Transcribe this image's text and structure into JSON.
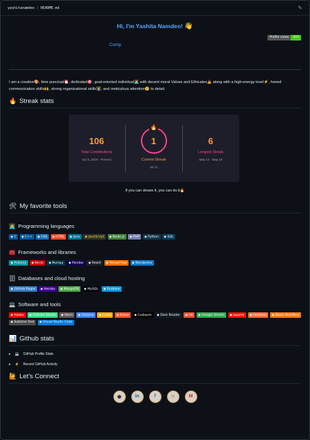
{
  "header": {
    "user": "yashitanamdeo",
    "sep": " / ",
    "file": "README.md",
    "edit_icon": "pencil-icon"
  },
  "hero": {
    "greeting": "Hi, I'm Yashita Namdeo!",
    "wave": "👋",
    "profile_views_label": "Profile views",
    "profile_views_count": "323",
    "typing_text": "Comp"
  },
  "intro": {
    "p1": "I am a creative",
    "p2": ", time punctual",
    "p3": ", dedicated",
    "p4": ", goal-oriented individual",
    "p5": " with decent moral Values and Ethicates",
    "p6": " along with a high-energy level",
    "p7": ", honed communication skills",
    "p8": ", strong organizational skills",
    "p9": ", and meticulous attention",
    "p10": " to detail."
  },
  "streak": {
    "heading": "Streak stats",
    "total": "106",
    "total_label": "Total Contributions",
    "total_range": "Apr 5, 2019 - Present",
    "current": "1",
    "current_label": "Current Streak",
    "current_range": "Jul 11",
    "longest": "6",
    "longest_label": "Longest Streak",
    "longest_range": "May 14 - May 19",
    "motto": "If you can dream it, you can do it"
  },
  "tools": {
    "heading": "My favorite tools",
    "sections": [
      {
        "title": "Programming languages",
        "badges": [
          {
            "label": "C",
            "color": "#00599c"
          },
          {
            "label": "C++",
            "color": "#00599c"
          },
          {
            "label": "CSS",
            "color": "#1572b6"
          },
          {
            "label": "HTML",
            "color": "#e34f26"
          },
          {
            "label": "Java",
            "color": "#007396"
          },
          {
            "label": "JavaScript",
            "color": "#323330",
            "text": "#f7df1e"
          },
          {
            "label": "Node.js",
            "color": "#43853d"
          },
          {
            "label": "PHP",
            "color": "#777bb4"
          },
          {
            "label": "Python",
            "color": "#14354c"
          },
          {
            "label": "SQL",
            "color": "#07405e"
          }
        ]
      },
      {
        "title": "Frameworks and libraries",
        "badges": [
          {
            "label": "Arduino",
            "color": "#00979d"
          },
          {
            "label": "Keras",
            "color": "#d00000"
          },
          {
            "label": "Numpy",
            "color": "#013243"
          },
          {
            "label": "Pandas",
            "color": "#150458"
          },
          {
            "label": "React",
            "color": "#20232a"
          },
          {
            "label": "TensorFlow",
            "color": "#ff6f00"
          },
          {
            "label": "Wordpress",
            "color": "#117ac9"
          }
        ]
      },
      {
        "title": "Databases and cloud hosting",
        "badges": [
          {
            "label": "GitHub Pages",
            "color": "#327fc7"
          },
          {
            "label": "Heroku",
            "color": "#430098"
          },
          {
            "label": "MongoDB",
            "color": "#4ea94b"
          },
          {
            "label": "MySQL",
            "color": "#00000f"
          },
          {
            "label": "Firebase",
            "color": "#039be5"
          }
        ]
      },
      {
        "title": "Software and tools",
        "badges": [
          {
            "label": "Adobe",
            "color": "#ff0000"
          },
          {
            "label": "Android Studio",
            "color": "#3ddc84"
          },
          {
            "label": "Atom",
            "color": "#66595c"
          },
          {
            "label": "Chrome",
            "color": "#4285f4"
          },
          {
            "label": "Colab",
            "color": "#f9ab00"
          },
          {
            "label": "Brave",
            "color": "#fb542b"
          },
          {
            "label": "Codepen",
            "color": "#000000"
          },
          {
            "label": "Dark Reader",
            "color": "#141e24"
          },
          {
            "label": "Git",
            "color": "#f05033"
          },
          {
            "label": "Google Sheets",
            "color": "#34a853"
          },
          {
            "label": "Jupyter",
            "color": "#fa0f00"
          },
          {
            "label": "Postman",
            "color": "#ff6c37"
          },
          {
            "label": "Stack Overflow",
            "color": "#fe7a16"
          },
          {
            "label": "Sublime Text",
            "color": "#4c4c4c"
          },
          {
            "label": "Visual Studio Code",
            "color": "#0078d7"
          }
        ]
      }
    ]
  },
  "github": {
    "heading": "Github stats",
    "items": [
      "GitHub Profile Stats",
      "Recent GitHub Activity"
    ]
  },
  "connect": {
    "heading": "Let's Connect",
    "icons": [
      "github-icon",
      "linkedin-icon",
      "facebook-icon",
      "codechef-icon",
      "gmail-icon"
    ]
  }
}
